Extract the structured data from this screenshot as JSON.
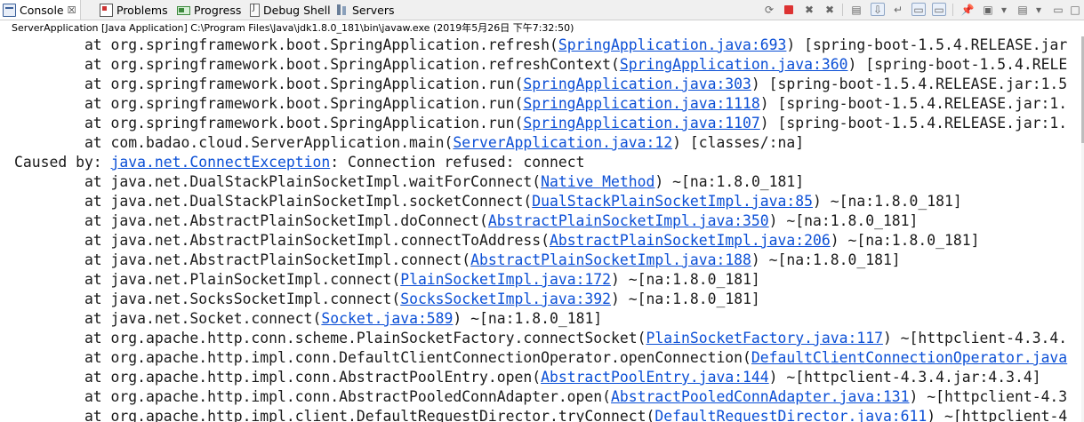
{
  "tabs": [
    {
      "id": "console",
      "label": "Console",
      "icon": "console-icon",
      "active": true
    },
    {
      "id": "problems",
      "label": "Problems",
      "icon": "problems-icon"
    },
    {
      "id": "progress",
      "label": "Progress",
      "icon": "progress-icon"
    },
    {
      "id": "debug_shell",
      "label": "Debug Shell",
      "icon": "debug-shell-icon"
    },
    {
      "id": "servers",
      "label": "Servers",
      "icon": "servers-icon"
    }
  ],
  "console_tab_close_glyph": "☒",
  "launch_description": "ServerApplication [Java Application] C:\\Program Files\\Java\\jdk1.8.0_181\\bin\\javaw.exe (2019年5月26日 下午7:32:50)",
  "colors": {
    "link": "#0b4fd6",
    "terminate": "#dd3333",
    "text": "#1a1a1a"
  },
  "lines": [
    {
      "indent": "        ",
      "pre": "at org.springframework.boot.SpringApplication.refresh(",
      "link": "SpringApplication.java:693",
      "post": ") [spring-boot-1.5.4.RELEASE.jar"
    },
    {
      "indent": "        ",
      "pre": "at org.springframework.boot.SpringApplication.refreshContext(",
      "link": "SpringApplication.java:360",
      "post": ") [spring-boot-1.5.4.RELE"
    },
    {
      "indent": "        ",
      "pre": "at org.springframework.boot.SpringApplication.run(",
      "link": "SpringApplication.java:303",
      "post": ") [spring-boot-1.5.4.RELEASE.jar:1.5"
    },
    {
      "indent": "        ",
      "pre": "at org.springframework.boot.SpringApplication.run(",
      "link": "SpringApplication.java:1118",
      "post": ") [spring-boot-1.5.4.RELEASE.jar:1."
    },
    {
      "indent": "        ",
      "pre": "at org.springframework.boot.SpringApplication.run(",
      "link": "SpringApplication.java:1107",
      "post": ") [spring-boot-1.5.4.RELEASE.jar:1."
    },
    {
      "indent": "        ",
      "pre": "at com.badao.cloud.ServerApplication.main(",
      "link": "ServerApplication.java:12",
      "post": ") [classes/:na]"
    },
    {
      "indent": "",
      "pre": "Caused by: ",
      "link": "java.net.ConnectException",
      "post": ": Connection refused: connect"
    },
    {
      "indent": "        ",
      "pre": "at java.net.DualStackPlainSocketImpl.waitForConnect(",
      "link": "Native Method",
      "post": ") ~[na:1.8.0_181]"
    },
    {
      "indent": "        ",
      "pre": "at java.net.DualStackPlainSocketImpl.socketConnect(",
      "link": "DualStackPlainSocketImpl.java:85",
      "post": ") ~[na:1.8.0_181]"
    },
    {
      "indent": "        ",
      "pre": "at java.net.AbstractPlainSocketImpl.doConnect(",
      "link": "AbstractPlainSocketImpl.java:350",
      "post": ") ~[na:1.8.0_181]"
    },
    {
      "indent": "        ",
      "pre": "at java.net.AbstractPlainSocketImpl.connectToAddress(",
      "link": "AbstractPlainSocketImpl.java:206",
      "post": ") ~[na:1.8.0_181]"
    },
    {
      "indent": "        ",
      "pre": "at java.net.AbstractPlainSocketImpl.connect(",
      "link": "AbstractPlainSocketImpl.java:188",
      "post": ") ~[na:1.8.0_181]"
    },
    {
      "indent": "        ",
      "pre": "at java.net.PlainSocketImpl.connect(",
      "link": "PlainSocketImpl.java:172",
      "post": ") ~[na:1.8.0_181]"
    },
    {
      "indent": "        ",
      "pre": "at java.net.SocksSocketImpl.connect(",
      "link": "SocksSocketImpl.java:392",
      "post": ") ~[na:1.8.0_181]"
    },
    {
      "indent": "        ",
      "pre": "at java.net.Socket.connect(",
      "link": "Socket.java:589",
      "post": ") ~[na:1.8.0_181]"
    },
    {
      "indent": "        ",
      "pre": "at org.apache.http.conn.scheme.PlainSocketFactory.connectSocket(",
      "link": "PlainSocketFactory.java:117",
      "post": ") ~[httpclient-4.3.4."
    },
    {
      "indent": "        ",
      "pre": "at org.apache.http.impl.conn.DefaultClientConnectionOperator.openConnection(",
      "link": "DefaultClientConnectionOperator.java",
      "post": ""
    },
    {
      "indent": "        ",
      "pre": "at org.apache.http.impl.conn.AbstractPoolEntry.open(",
      "link": "AbstractPoolEntry.java:144",
      "post": ") ~[httpclient-4.3.4.jar:4.3.4]"
    },
    {
      "indent": "        ",
      "pre": "at org.apache.http.impl.conn.AbstractPooledConnAdapter.open(",
      "link": "AbstractPooledConnAdapter.java:131",
      "post": ") ~[httpclient-4.3"
    },
    {
      "indent": "        ",
      "pre": "at org.apache.http.impl.client.DefaultRequestDirector.tryConnect(",
      "link": "DefaultRequestDirector.java:611",
      "post": ") ~[httpclient-4"
    }
  ]
}
